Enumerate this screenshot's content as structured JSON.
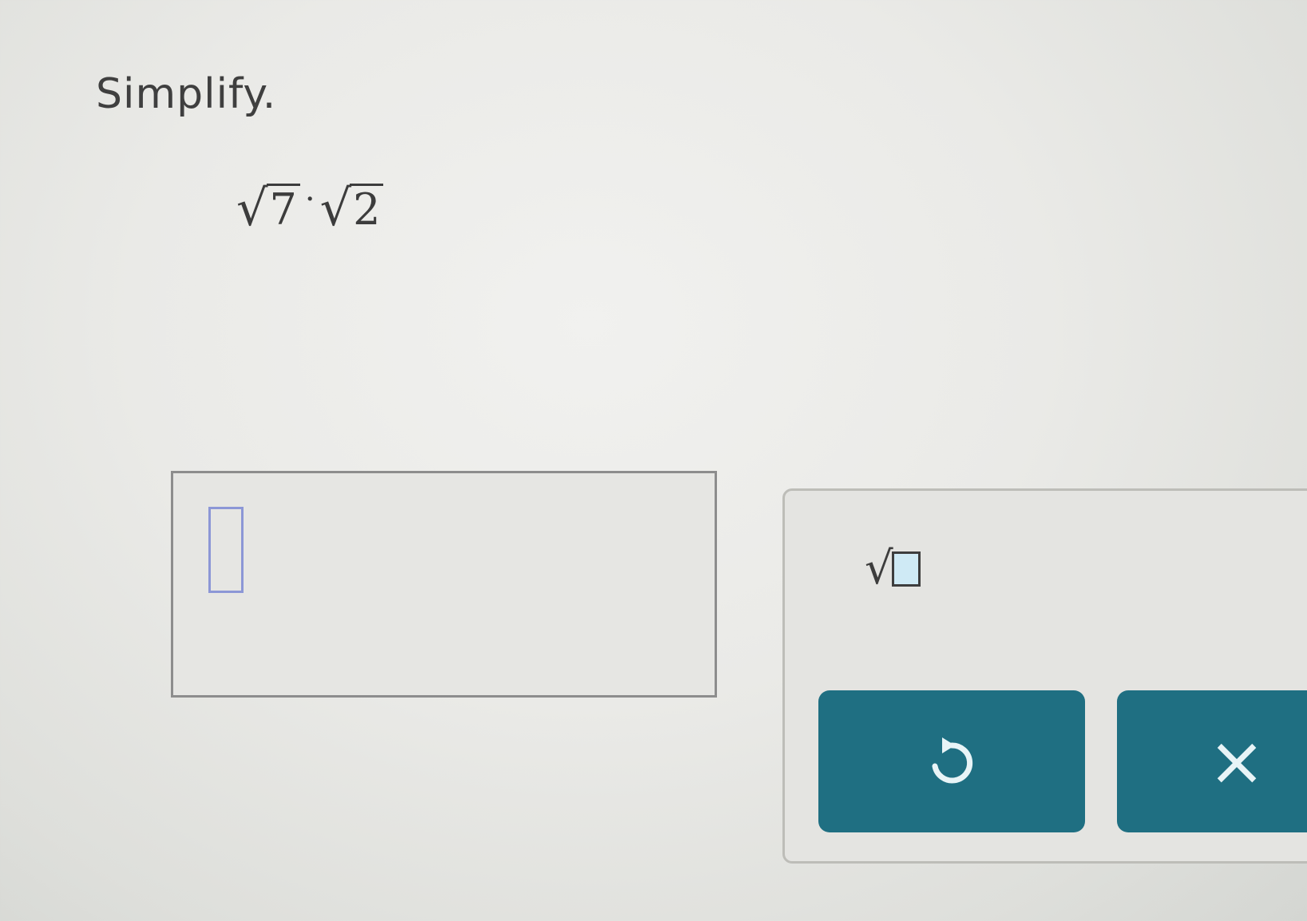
{
  "prompt": {
    "instruction": "Simplify."
  },
  "expression": {
    "radicand_a": "7",
    "operator": "·",
    "radicand_b": "2"
  },
  "answer": {
    "value": ""
  },
  "keypad": {
    "sqrt_label": "√",
    "undo_icon": "undo-icon",
    "clear_label": "×"
  },
  "colors": {
    "button": "#1f6f82",
    "cursor_outline": "#8c97d6"
  }
}
